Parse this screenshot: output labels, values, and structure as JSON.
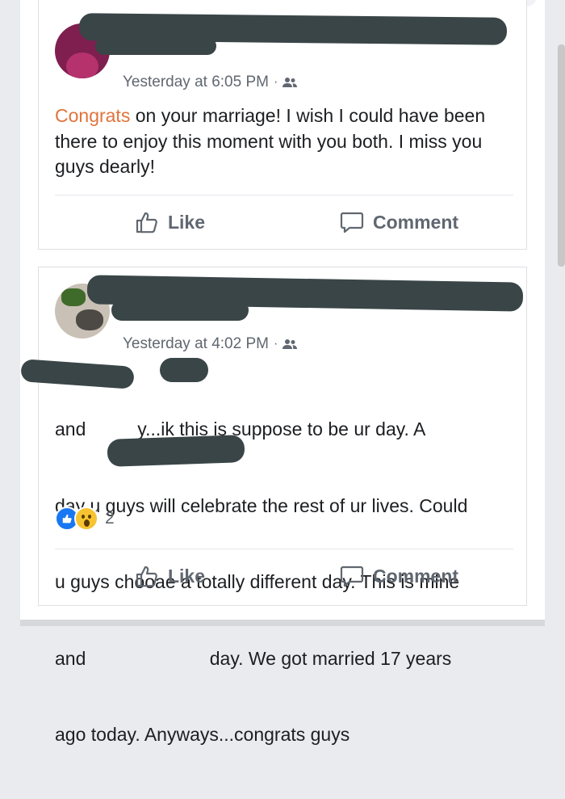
{
  "posts": [
    {
      "timestamp": "Yesterday at 6:05 PM",
      "separator": "·",
      "audience_icon": "friends-icon",
      "text_highlight": "Congrats",
      "text": " on your marriage! I wish I could have been there to enjoy this moment with you both. I miss you guys dearly!",
      "like_label": "Like",
      "comment_label": "Comment"
    },
    {
      "timestamp": "Yesterday at 4:02 PM",
      "separator": "·",
      "audience_icon": "friends-icon",
      "text_lines": [
        "and          y...ik this is suppose to be ur day. A",
        "day u guys will celebrate the rest of ur lives. Could",
        "u guys chooae a totally different day. This is mine",
        "and                        day. We got married 17 years",
        "ago today. Anyways...congrats guys"
      ],
      "reaction_icons": [
        "like-reaction-icon",
        "wow-reaction-icon"
      ],
      "reaction_count": "2",
      "like_label": "Like",
      "comment_label": "Comment"
    }
  ],
  "colors": {
    "highlight": "#e0743b",
    "redaction": "#3a4547",
    "like_blue": "#1877f2",
    "meta_gray": "#606770"
  }
}
